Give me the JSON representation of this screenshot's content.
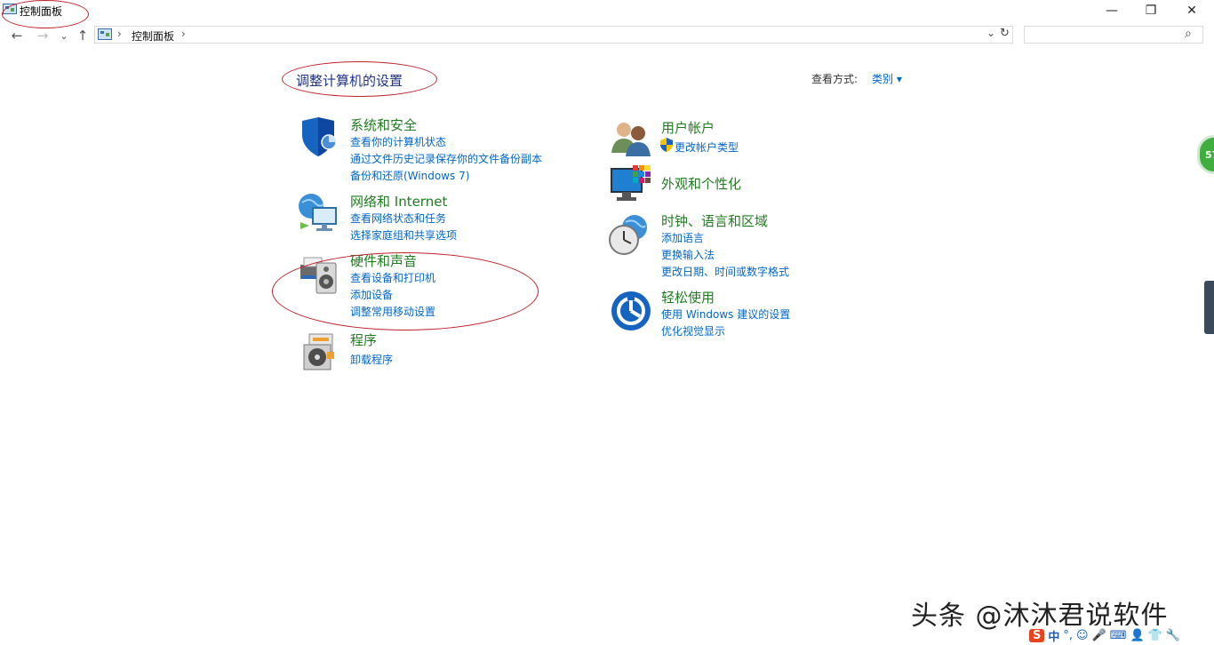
{
  "window": {
    "title": "控制面板",
    "minimize": "—",
    "restore": "❐",
    "close": "✕"
  },
  "nav": {
    "back": "←",
    "forward": "→",
    "recent": "⌄",
    "up": "↑",
    "breadcrumb_root": "控制面板",
    "chevron": "›",
    "dropdown": "⌄",
    "refresh": "↻",
    "search_icon": "⌕",
    "search_placeholder": ""
  },
  "page": {
    "heading": "调整计算机的设置",
    "view_by_label": "查看方式:",
    "view_by_value": "类别 ▾"
  },
  "categories_left": [
    {
      "title": "系统和安全",
      "icon": "shield-icon",
      "links": [
        "查看你的计算机状态",
        "通过文件历史记录保存你的文件备份副本",
        "备份和还原(Windows 7)"
      ]
    },
    {
      "title": "网络和 Internet",
      "icon": "network-globe-icon",
      "links": [
        "查看网络状态和任务",
        "选择家庭组和共享选项"
      ]
    },
    {
      "title": "硬件和声音",
      "icon": "printer-speaker-icon",
      "links": [
        "查看设备和打印机",
        "添加设备",
        "调整常用移动设置"
      ]
    },
    {
      "title": "程序",
      "icon": "programs-disc-icon",
      "links": [
        "卸载程序"
      ]
    }
  ],
  "categories_right": [
    {
      "title": "用户帐户",
      "icon": "users-icon",
      "links": [
        "更改帐户类型"
      ]
    },
    {
      "title": "外观和个性化",
      "icon": "monitor-palette-icon",
      "links": []
    },
    {
      "title": "时钟、语言和区域",
      "icon": "clock-globe-icon",
      "links": [
        "添加语言",
        "更换输入法",
        "更改日期、时间或数字格式"
      ]
    },
    {
      "title": "轻松使用",
      "icon": "ease-of-access-icon",
      "links": [
        "使用 Windows 建议的设置",
        "优化视觉显示"
      ]
    }
  ],
  "side_badge": "57",
  "watermark": "头条 @沐沐君说软件",
  "ime": {
    "logo": "S",
    "mode": "中",
    "punct": "°,"
  },
  "colors": {
    "title_green": "#1e7d1e",
    "link_blue": "#0066cc",
    "heading_blue": "#1e3287",
    "annotation_red": "#c0202a"
  }
}
